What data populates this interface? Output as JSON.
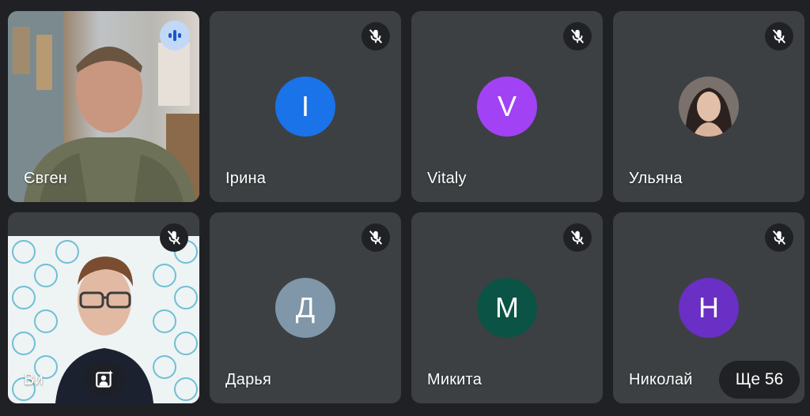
{
  "participants": [
    {
      "name": "Євген",
      "type": "video",
      "status": "speaking"
    },
    {
      "name": "Ірина",
      "type": "avatar",
      "initial": "I",
      "color": "#1a73e8",
      "status": "muted"
    },
    {
      "name": "Vitaly",
      "type": "avatar",
      "initial": "V",
      "color": "#a142f4",
      "status": "muted"
    },
    {
      "name": "Ульяна",
      "type": "photo",
      "status": "muted"
    },
    {
      "name": "Ви",
      "type": "video",
      "status": "muted"
    },
    {
      "name": "Дарья",
      "type": "avatar",
      "initial": "Д",
      "color": "#7f97a8",
      "status": "muted"
    },
    {
      "name": "Микита",
      "type": "avatar",
      "initial": "M",
      "color": "#0b5345",
      "status": "muted"
    },
    {
      "name": "Николай",
      "type": "avatar",
      "initial": "H",
      "color": "#6a2fc4",
      "status": "muted"
    }
  ],
  "more_button_label": "Ще 56",
  "icons": {
    "mute": "mic-off-icon",
    "speaking": "audio-level-icon",
    "reframe": "reframe-icon"
  },
  "colors": {
    "background": "#202124",
    "tile": "#3c4043",
    "speaking_badge": "#c2d8f7"
  }
}
